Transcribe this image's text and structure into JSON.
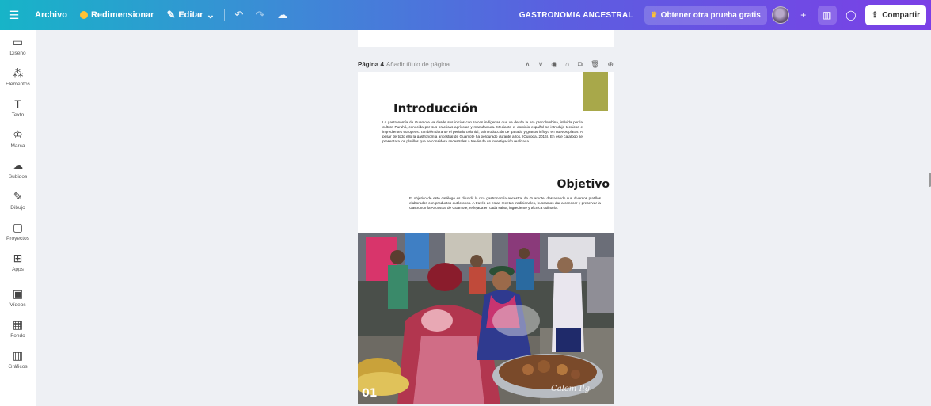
{
  "topbar": {
    "menu_icon": "menu-icon",
    "file_label": "Archivo",
    "resize_label": "Redimensionar",
    "edit_label": "Editar",
    "doc_title": "GASTRONOMIA ANCESTRAL",
    "trial_label": "Obtener otra prueba gratis",
    "share_label": "Compartir",
    "colors": {
      "gradient_start": "#17b4c8",
      "gradient_end": "#7b3fe6",
      "crown": "#ffc233"
    }
  },
  "sidebar": {
    "items": [
      {
        "label": "Diseño",
        "icon": "design-icon"
      },
      {
        "label": "Elementos",
        "icon": "elements-icon"
      },
      {
        "label": "Texto",
        "icon": "text-icon"
      },
      {
        "label": "Marca",
        "icon": "brand-icon"
      },
      {
        "label": "Subidos",
        "icon": "uploads-icon"
      },
      {
        "label": "Dibujo",
        "icon": "draw-icon"
      },
      {
        "label": "Proyectos",
        "icon": "projects-icon"
      },
      {
        "label": "Apps",
        "icon": "apps-icon"
      },
      {
        "label": "Vídeos",
        "icon": "videos-icon"
      },
      {
        "label": "Fondo",
        "icon": "background-icon"
      },
      {
        "label": "Gráficos",
        "icon": "charts-icon"
      }
    ]
  },
  "page": {
    "name": "Página 4",
    "title_placeholder": "Añadir título de página",
    "accent_color": "#a8a84a",
    "intro_title": "Introducción",
    "intro_text": "La gastronomía de Guamote va desde sus inicios con raíces indígenas que va desde la era precolombina, influida por la cultura Puruhá, conocida por sus prácticas agrícolas y manufactura. Mediante el dominio español se introdujo técnicas e ingredientes europeos. También durante el periodo colonial, la introducción de ganado y granos influyo en nuevos platos. A pesar de todo ello la gastronomía ancestral de Guamote ha perdurado durante años. (Quiroga, 2016). En este catalogo se presentara los platillos que se considera ancestrales a través de un investigación realizada.",
    "objective_title": "Objetivo",
    "objective_text": "El objetivo de este catálogo es difundir la rica gastronomía ancestral de Guamote, destacando sus diversos platillos elaborados con productos autóctonos. A través de estas recetas tradicionales, buscamos dar a conocer y preservar la Gastronomía Ancestral de Guamote, reflejada en cada sabor, ingrediente y técnica culinaria.",
    "photo_number": "01",
    "photo_signature": "Calem Ilg"
  }
}
